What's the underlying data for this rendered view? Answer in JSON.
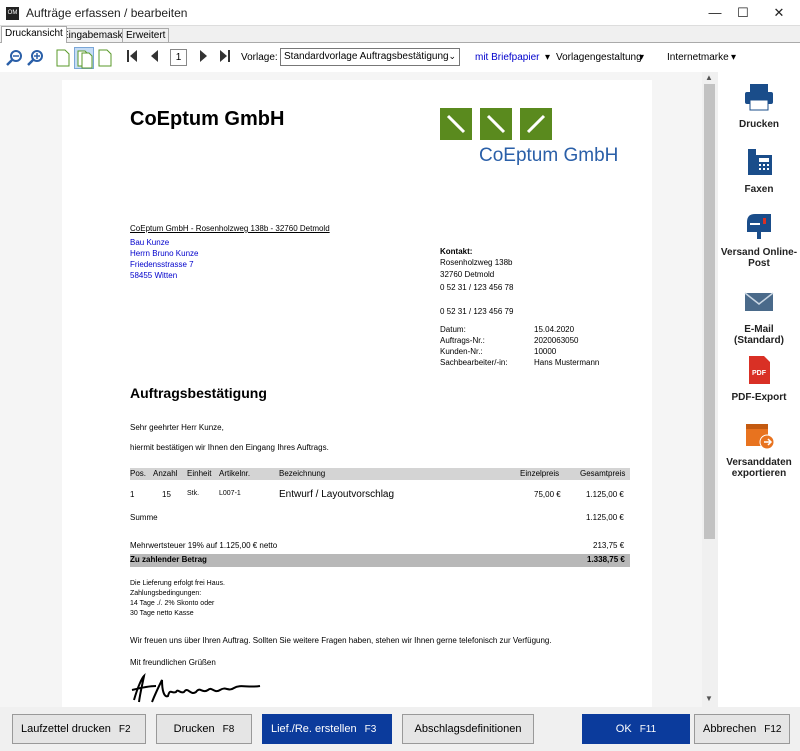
{
  "window": {
    "title": "Aufträge erfassen / bearbeiten",
    "app_icon": "OM"
  },
  "tabs": [
    {
      "label": "Druckansicht"
    },
    {
      "label": "Eingabemaske"
    },
    {
      "label": "Erweitert"
    }
  ],
  "toolbar": {
    "page": "1",
    "vorlage_label": "Vorlage:",
    "vorlage_value": "Standardvorlage Auftragsbestätigung",
    "briefpapier": "mit Briefpapier",
    "vorlagengestaltung": "Vorlagengestaltung",
    "internetmarke": "Internetmarke"
  },
  "sidebar": [
    {
      "label": "Drucken",
      "icon": "printer-icon"
    },
    {
      "label": "Faxen",
      "icon": "fax-icon"
    },
    {
      "label": "Versand Online-Post",
      "icon": "mailbox-icon"
    },
    {
      "label": "E-Mail (Standard)",
      "icon": "envelope-icon"
    },
    {
      "label": "PDF-Export",
      "icon": "pdf-icon"
    },
    {
      "label": "Versanddaten exportieren",
      "icon": "export-box-icon"
    }
  ],
  "footer": {
    "laufzettel": "Laufzettel drucken",
    "laufzettel_key": "F2",
    "drucken": "Drucken",
    "drucken_key": "F8",
    "lief": "Lief./Re. erstellen",
    "lief_key": "F3",
    "abschlag": "Abschlagsdefinitionen",
    "ok": "OK",
    "ok_key": "F11",
    "abbrechen": "Abbrechen",
    "abbrechen_key": "F12"
  },
  "document": {
    "company": "CoEptum GmbH",
    "logo_text": "CoEptum GmbH",
    "sender_line": "CoEptum GmbH - Rosenholzweg 138b - 32760 Detmold",
    "recipient": [
      "Bau Kunze",
      "Herrn Bruno Kunze",
      "Friedensstrasse 7",
      "58455 Witten"
    ],
    "contact_label": "Kontakt:",
    "contact": [
      "Rosenholzweg 138b",
      "32760 Detmold",
      "0 52 31 / 123 456 78",
      "0 52 31 / 123 456 79"
    ],
    "meta": [
      {
        "label": "Datum:",
        "value": "15.04.2020"
      },
      {
        "label": "Auftrags-Nr.:",
        "value": "2020063050"
      },
      {
        "label": "Kunden-Nr.:",
        "value": "10000"
      },
      {
        "label": "Sachbearbeiter/-in:",
        "value": "Hans Mustermann"
      }
    ],
    "heading": "Auftragsbestätigung",
    "salutation": "Sehr geehrter Herr Kunze,",
    "intro": "hiermit bestätigen wir Ihnen den Eingang Ihres Auftrags.",
    "table_headers": [
      "Pos.",
      "Anzahl",
      "Einheit",
      "Artikelnr.",
      "Bezeichnung",
      "Einzelpreis",
      "Gesamtpreis"
    ],
    "row": [
      "1",
      "15",
      "Stk.",
      "L007-1",
      "Entwurf / Layoutvorschlag",
      "75,00 €",
      "1.125,00 €"
    ],
    "summe_label": "Summe",
    "summe": "1.125,00 €",
    "mwst_label": "Mehrwertsteuer 19% auf 1.125,00 € netto",
    "mwst": "213,75 €",
    "total_label": "Zu zahlender Betrag",
    "total": "1.338,75 €",
    "terms": [
      "Die Lieferung erfolgt frei Haus.",
      "Zahlungsbedingungen:",
      "14 Tage ./. 2% Skonto oder",
      "30 Tage netto Kasse"
    ],
    "closing": "Wir freuen uns über Ihren Auftrag.  Sollten Sie weitere Fragen haben, stehen wir Ihnen gerne telefonisch zur Verfügung.",
    "greeting": "Mit freundlichen Grüßen"
  }
}
